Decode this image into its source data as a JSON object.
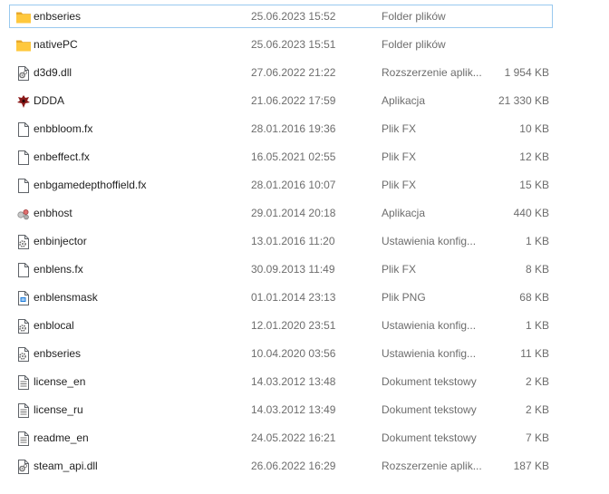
{
  "files": [
    {
      "name": "enbseries",
      "date": "25.06.2023 15:52",
      "type": "Folder plików",
      "size": "",
      "icon": "folder-icon",
      "selected": true
    },
    {
      "name": "nativePC",
      "date": "25.06.2023 15:51",
      "type": "Folder plików",
      "size": "",
      "icon": "folder-icon"
    },
    {
      "name": "d3d9.dll",
      "date": "27.06.2022 21:22",
      "type": "Rozszerzenie aplik...",
      "size": "1 954 KB",
      "icon": "dll-file-icon"
    },
    {
      "name": "DDDA",
      "date": "21.06.2022 17:59",
      "type": "Aplikacja",
      "size": "21 330 KB",
      "icon": "ddda-app-icon"
    },
    {
      "name": "enbbloom.fx",
      "date": "28.01.2016 19:36",
      "type": "Plik FX",
      "size": "10 KB",
      "icon": "file-icon"
    },
    {
      "name": "enbeffect.fx",
      "date": "16.05.2021 02:55",
      "type": "Plik FX",
      "size": "12 KB",
      "icon": "file-icon"
    },
    {
      "name": "enbgamedepthoffield.fx",
      "date": "28.01.2016 10:07",
      "type": "Plik FX",
      "size": "15 KB",
      "icon": "file-icon"
    },
    {
      "name": "enbhost",
      "date": "29.01.2014 20:18",
      "type": "Aplikacja",
      "size": "440 KB",
      "icon": "enbhost-app-icon"
    },
    {
      "name": "enbinjector",
      "date": "13.01.2016 11:20",
      "type": "Ustawienia konfig...",
      "size": "1 KB",
      "icon": "config-file-icon"
    },
    {
      "name": "enblens.fx",
      "date": "30.09.2013 11:49",
      "type": "Plik FX",
      "size": "8 KB",
      "icon": "file-icon"
    },
    {
      "name": "enblensmask",
      "date": "01.01.2014 23:13",
      "type": "Plik PNG",
      "size": "68 KB",
      "icon": "png-file-icon"
    },
    {
      "name": "enblocal",
      "date": "12.01.2020 23:51",
      "type": "Ustawienia konfig...",
      "size": "1 KB",
      "icon": "config-file-icon"
    },
    {
      "name": "enbseries",
      "date": "10.04.2020 03:56",
      "type": "Ustawienia konfig...",
      "size": "11 KB",
      "icon": "config-file-icon"
    },
    {
      "name": "license_en",
      "date": "14.03.2012 13:48",
      "type": "Dokument tekstowy",
      "size": "2 KB",
      "icon": "text-file-icon"
    },
    {
      "name": "license_ru",
      "date": "14.03.2012 13:49",
      "type": "Dokument tekstowy",
      "size": "2 KB",
      "icon": "text-file-icon"
    },
    {
      "name": "readme_en",
      "date": "24.05.2022 16:21",
      "type": "Dokument tekstowy",
      "size": "7 KB",
      "icon": "text-file-icon"
    },
    {
      "name": "steam_api.dll",
      "date": "26.06.2022 16:29",
      "type": "Rozszerzenie aplik...",
      "size": "187 KB",
      "icon": "dll-file-icon"
    }
  ]
}
